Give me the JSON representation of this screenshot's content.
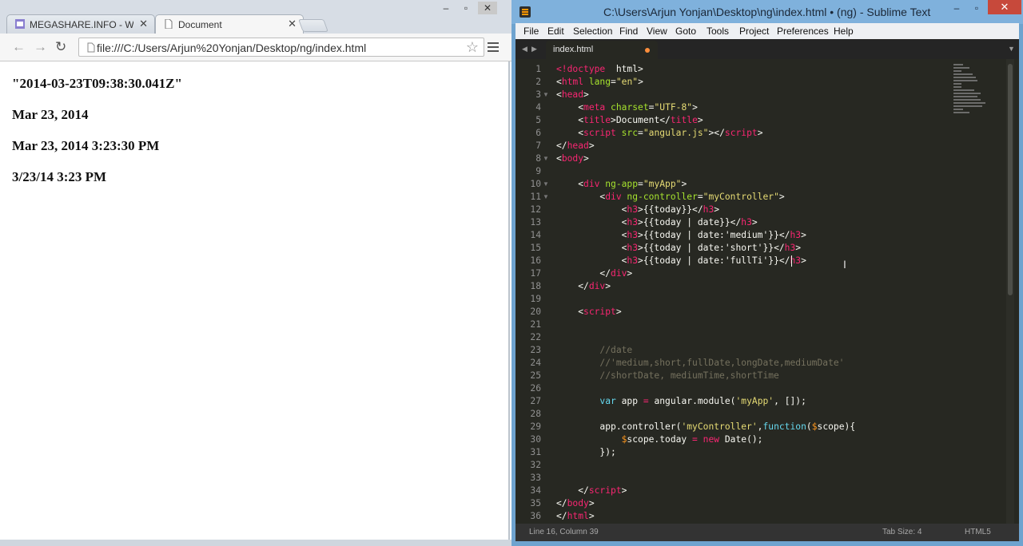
{
  "browser": {
    "tabs": [
      {
        "label": "MEGASHARE.INFO - Watc"
      },
      {
        "label": "Document"
      }
    ],
    "url": "file:///C:/Users/Arjun%20Yonjan/Desktop/ng/index.html",
    "output": [
      "\"2014-03-23T09:38:30.041Z\"",
      "Mar 23, 2014",
      "Mar 23, 2014 3:23:30 PM",
      "3/23/14 3:23 PM"
    ]
  },
  "editor": {
    "title": "C:\\Users\\Arjun Yonjan\\Desktop\\ng\\index.html • (ng) - Sublime Text",
    "menu": [
      "File",
      "Edit",
      "Selection",
      "Find",
      "View",
      "Goto",
      "Tools",
      "Project",
      "Preferences",
      "Help"
    ],
    "tab_label": "index.html",
    "line_numbers": [
      "1",
      "2",
      "3",
      "4",
      "5",
      "6",
      "7",
      "8",
      "9",
      "10",
      "11",
      "12",
      "13",
      "14",
      "15",
      "16",
      "17",
      "18",
      "19",
      "20",
      "21",
      "22",
      "23",
      "24",
      "25",
      "26",
      "27",
      "28",
      "29",
      "30",
      "31",
      "32",
      "33",
      "34",
      "35",
      "36"
    ],
    "fold_lines": [
      3,
      8,
      10,
      11
    ],
    "code_lines": [
      [
        [
          "t",
          "<!"
        ],
        [
          "t",
          "doctype"
        ],
        [
          "",
          "  html>"
        ]
      ],
      [
        [
          "",
          "<"
        ],
        [
          "t",
          "html"
        ],
        [
          "a",
          " lang"
        ],
        [
          "",
          "="
        ],
        [
          "s",
          "\"en\""
        ],
        [
          "",
          ">"
        ]
      ],
      [
        [
          "",
          "<"
        ],
        [
          "t",
          "head"
        ],
        [
          "",
          ">"
        ]
      ],
      [
        [
          "",
          "    <"
        ],
        [
          "t",
          "meta"
        ],
        [
          "a",
          " charset"
        ],
        [
          "",
          "="
        ],
        [
          "s",
          "\"UTF-8\""
        ],
        [
          "",
          ">"
        ]
      ],
      [
        [
          "",
          "    <"
        ],
        [
          "t",
          "title"
        ],
        [
          "",
          ">Document</"
        ],
        [
          "t",
          "title"
        ],
        [
          "",
          ">"
        ]
      ],
      [
        [
          "",
          "    <"
        ],
        [
          "t",
          "script"
        ],
        [
          "a",
          " src"
        ],
        [
          "",
          "="
        ],
        [
          "s",
          "\"angular.js\""
        ],
        [
          "",
          "></"
        ],
        [
          "t",
          "script"
        ],
        [
          "",
          ">"
        ]
      ],
      [
        [
          "",
          "</"
        ],
        [
          "t",
          "head"
        ],
        [
          "",
          ">"
        ]
      ],
      [
        [
          "",
          "<"
        ],
        [
          "t",
          "body"
        ],
        [
          "",
          ">"
        ]
      ],
      [],
      [
        [
          "",
          "    <"
        ],
        [
          "t",
          "div"
        ],
        [
          "a",
          " ng-app"
        ],
        [
          "",
          "="
        ],
        [
          "s",
          "\"myApp\""
        ],
        [
          "",
          ">"
        ]
      ],
      [
        [
          "",
          "        <"
        ],
        [
          "t",
          "div"
        ],
        [
          "a",
          " ng-controller"
        ],
        [
          "",
          "="
        ],
        [
          "s",
          "\"myController\""
        ],
        [
          "",
          ">"
        ]
      ],
      [
        [
          "",
          "            <"
        ],
        [
          "t",
          "h3"
        ],
        [
          "",
          ">{{today}}</"
        ],
        [
          "t",
          "h3"
        ],
        [
          "",
          ">"
        ]
      ],
      [
        [
          "",
          "            <"
        ],
        [
          "t",
          "h3"
        ],
        [
          "",
          ">{{today | date}}</"
        ],
        [
          "t",
          "h3"
        ],
        [
          "",
          ">"
        ]
      ],
      [
        [
          "",
          "            <"
        ],
        [
          "t",
          "h3"
        ],
        [
          "",
          ">{{today | date:'medium'}}</"
        ],
        [
          "t",
          "h3"
        ],
        [
          "",
          ">"
        ]
      ],
      [
        [
          "",
          "            <"
        ],
        [
          "t",
          "h3"
        ],
        [
          "",
          ">{{today | date:'short'}}</"
        ],
        [
          "t",
          "h3"
        ],
        [
          "",
          ">"
        ]
      ],
      [
        [
          "",
          "            <"
        ],
        [
          "t",
          "h3"
        ],
        [
          "",
          ">{{today | date:'fullTi'}}</"
        ],
        [
          "t",
          "h3"
        ],
        [
          "",
          ">"
        ]
      ],
      [
        [
          "",
          "        </"
        ],
        [
          "t",
          "div"
        ],
        [
          "",
          ">"
        ]
      ],
      [
        [
          "",
          "    </"
        ],
        [
          "t",
          "div"
        ],
        [
          "",
          ">"
        ]
      ],
      [],
      [
        [
          "",
          "    <"
        ],
        [
          "t",
          "script"
        ],
        [
          "",
          ">"
        ]
      ],
      [],
      [],
      [
        [
          "c",
          "        //date"
        ]
      ],
      [
        [
          "c",
          "        //'medium,short,fullDate,longDate,mediumDate'"
        ]
      ],
      [
        [
          "c",
          "        //shortDate, mediumTime,shortTime"
        ]
      ],
      [],
      [
        [
          "f",
          "        var"
        ],
        [
          "",
          " app "
        ],
        [
          "o",
          "="
        ],
        [
          "",
          " angular.module("
        ],
        [
          "s",
          "'myApp'"
        ],
        [
          "",
          ", []);"
        ]
      ],
      [],
      [
        [
          "",
          "        app.controller("
        ],
        [
          "s",
          "'myController'"
        ],
        [
          "",
          ","
        ],
        [
          "f",
          "function"
        ],
        [
          "",
          "("
        ],
        [
          "v",
          "$"
        ],
        [
          "",
          "scope){"
        ]
      ],
      [
        [
          "v",
          "            $"
        ],
        [
          "",
          "scope.today "
        ],
        [
          "o",
          "="
        ],
        [
          "o",
          " new"
        ],
        [
          "",
          " Date();"
        ]
      ],
      [
        [
          "",
          "        });"
        ]
      ],
      [],
      [],
      [
        [
          "",
          "    </"
        ],
        [
          "t",
          "script"
        ],
        [
          "",
          ">"
        ]
      ],
      [
        [
          "",
          "</"
        ],
        [
          "t",
          "body"
        ],
        [
          "",
          ">"
        ]
      ],
      [
        [
          "",
          "</"
        ],
        [
          "t",
          "html"
        ],
        [
          "",
          ">"
        ]
      ]
    ],
    "status": {
      "position": "Line 16, Column 39",
      "tab_size": "Tab Size: 4",
      "syntax": "HTML5"
    }
  },
  "colors": {
    "editor_bg": "#272822",
    "tag": "#f92672",
    "attr": "#a6e22e",
    "string": "#e6db74",
    "comment": "#75715e",
    "keyword": "#66d9ef",
    "variable": "#fd971f"
  }
}
